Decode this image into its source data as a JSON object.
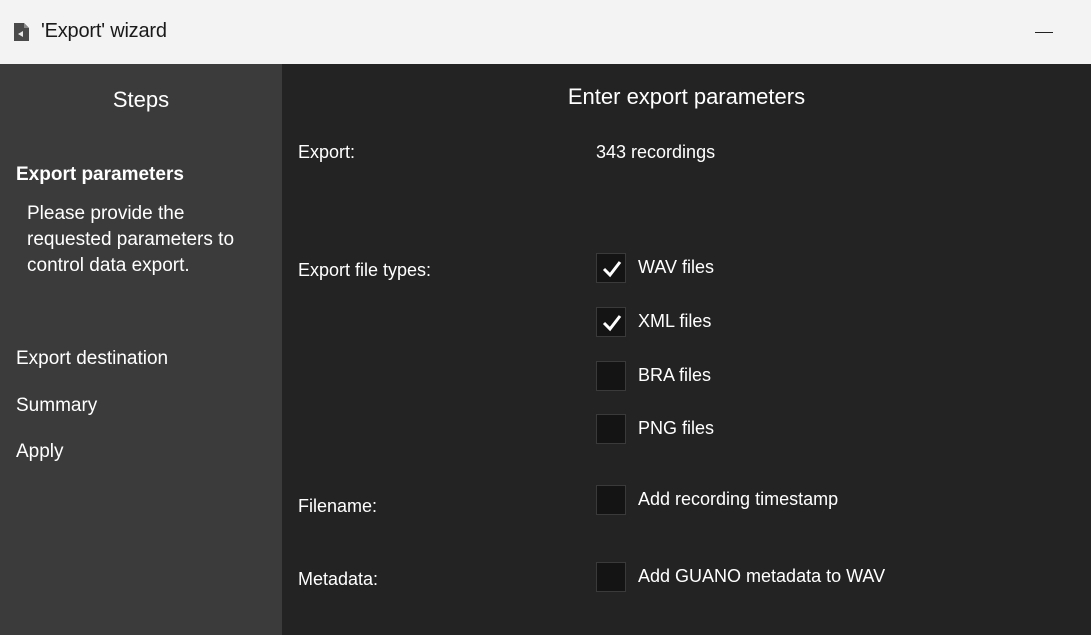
{
  "window": {
    "title": "'Export' wizard",
    "icon": "document-icon"
  },
  "sidebar": {
    "heading": "Steps",
    "steps": [
      {
        "label": "Export parameters",
        "active": true,
        "description": "Please provide the requested parameters to control data export."
      },
      {
        "label": "Export destination",
        "active": false
      },
      {
        "label": "Summary",
        "active": false
      },
      {
        "label": "Apply",
        "active": false
      }
    ]
  },
  "main": {
    "title": "Enter export parameters",
    "export_label": "Export:",
    "export_value": "343 recordings",
    "file_types_label": "Export file types:",
    "file_types": [
      {
        "label": "WAV files",
        "checked": true
      },
      {
        "label": "XML files",
        "checked": true
      },
      {
        "label": "BRA files",
        "checked": false
      },
      {
        "label": "PNG files",
        "checked": false
      }
    ],
    "filename_label": "Filename:",
    "filename_option": {
      "label": "Add recording timestamp",
      "checked": false
    },
    "metadata_label": "Metadata:",
    "metadata_option": {
      "label": "Add GUANO metadata to WAV",
      "checked": false
    }
  },
  "colors": {
    "titlebar_bg": "#f3f3f3",
    "sidebar_bg": "#3b3b3b",
    "main_bg": "#232323",
    "checkbox_bg": "#141414"
  }
}
